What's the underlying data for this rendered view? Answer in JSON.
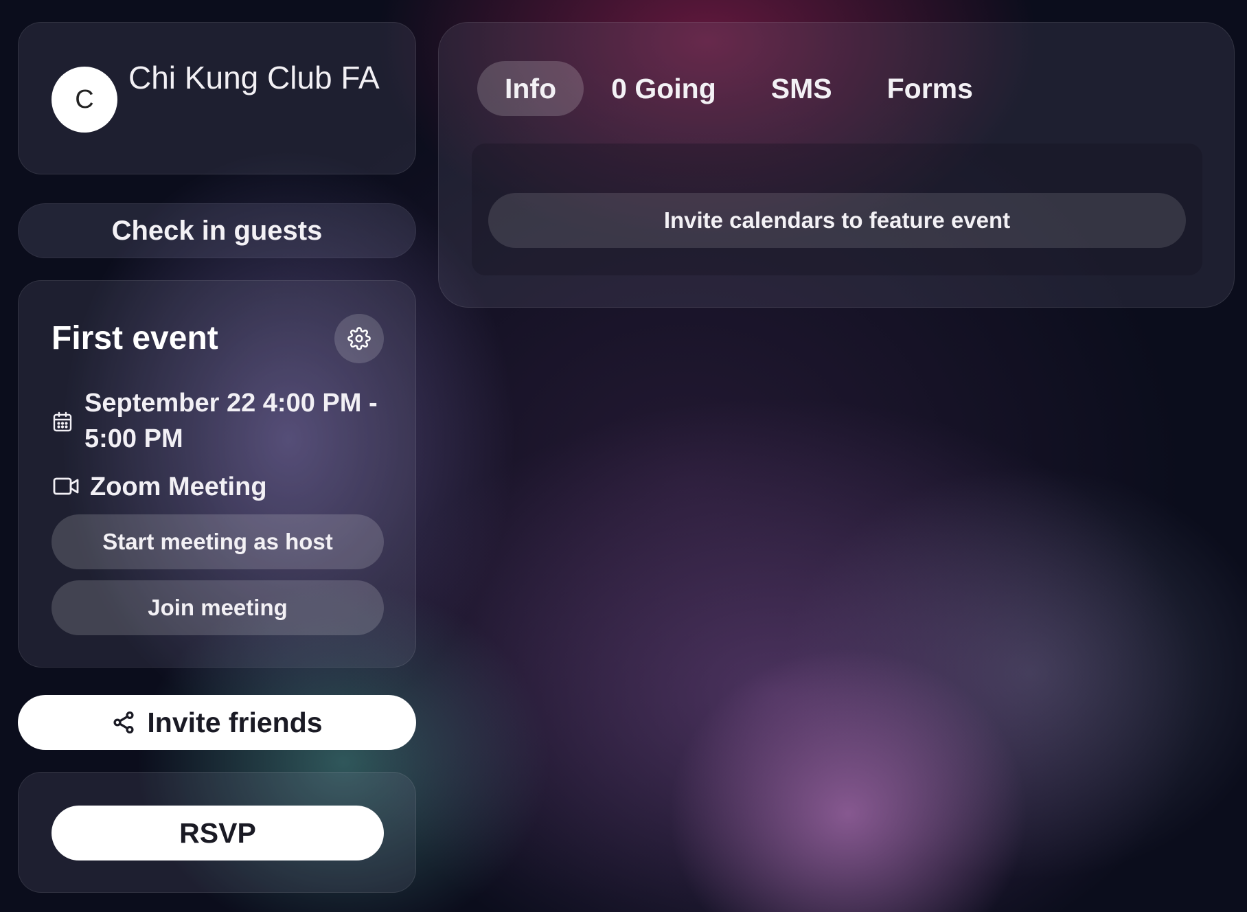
{
  "host": {
    "avatar_letter": "C",
    "name": "Chi Kung Club FA"
  },
  "check_in_label": "Check in guests",
  "event": {
    "title": "First event",
    "date": "September 22 4:00 PM - 5:00 PM",
    "location": "Zoom Meeting",
    "start_host_label": "Start meeting as host",
    "join_label": "Join meeting"
  },
  "invite_friends_label": "Invite friends",
  "rsvp_label": "RSVP",
  "tabs": [
    {
      "label": "Info",
      "active": true
    },
    {
      "label": "0 Going",
      "active": false
    },
    {
      "label": "SMS",
      "active": false
    },
    {
      "label": "Forms",
      "active": false
    }
  ],
  "invite_calendars_label": "Invite calendars to feature event",
  "icons": {
    "settings": "gear-icon",
    "date": "calendar-icon",
    "location": "video-camera-icon",
    "invite": "share-icon"
  }
}
